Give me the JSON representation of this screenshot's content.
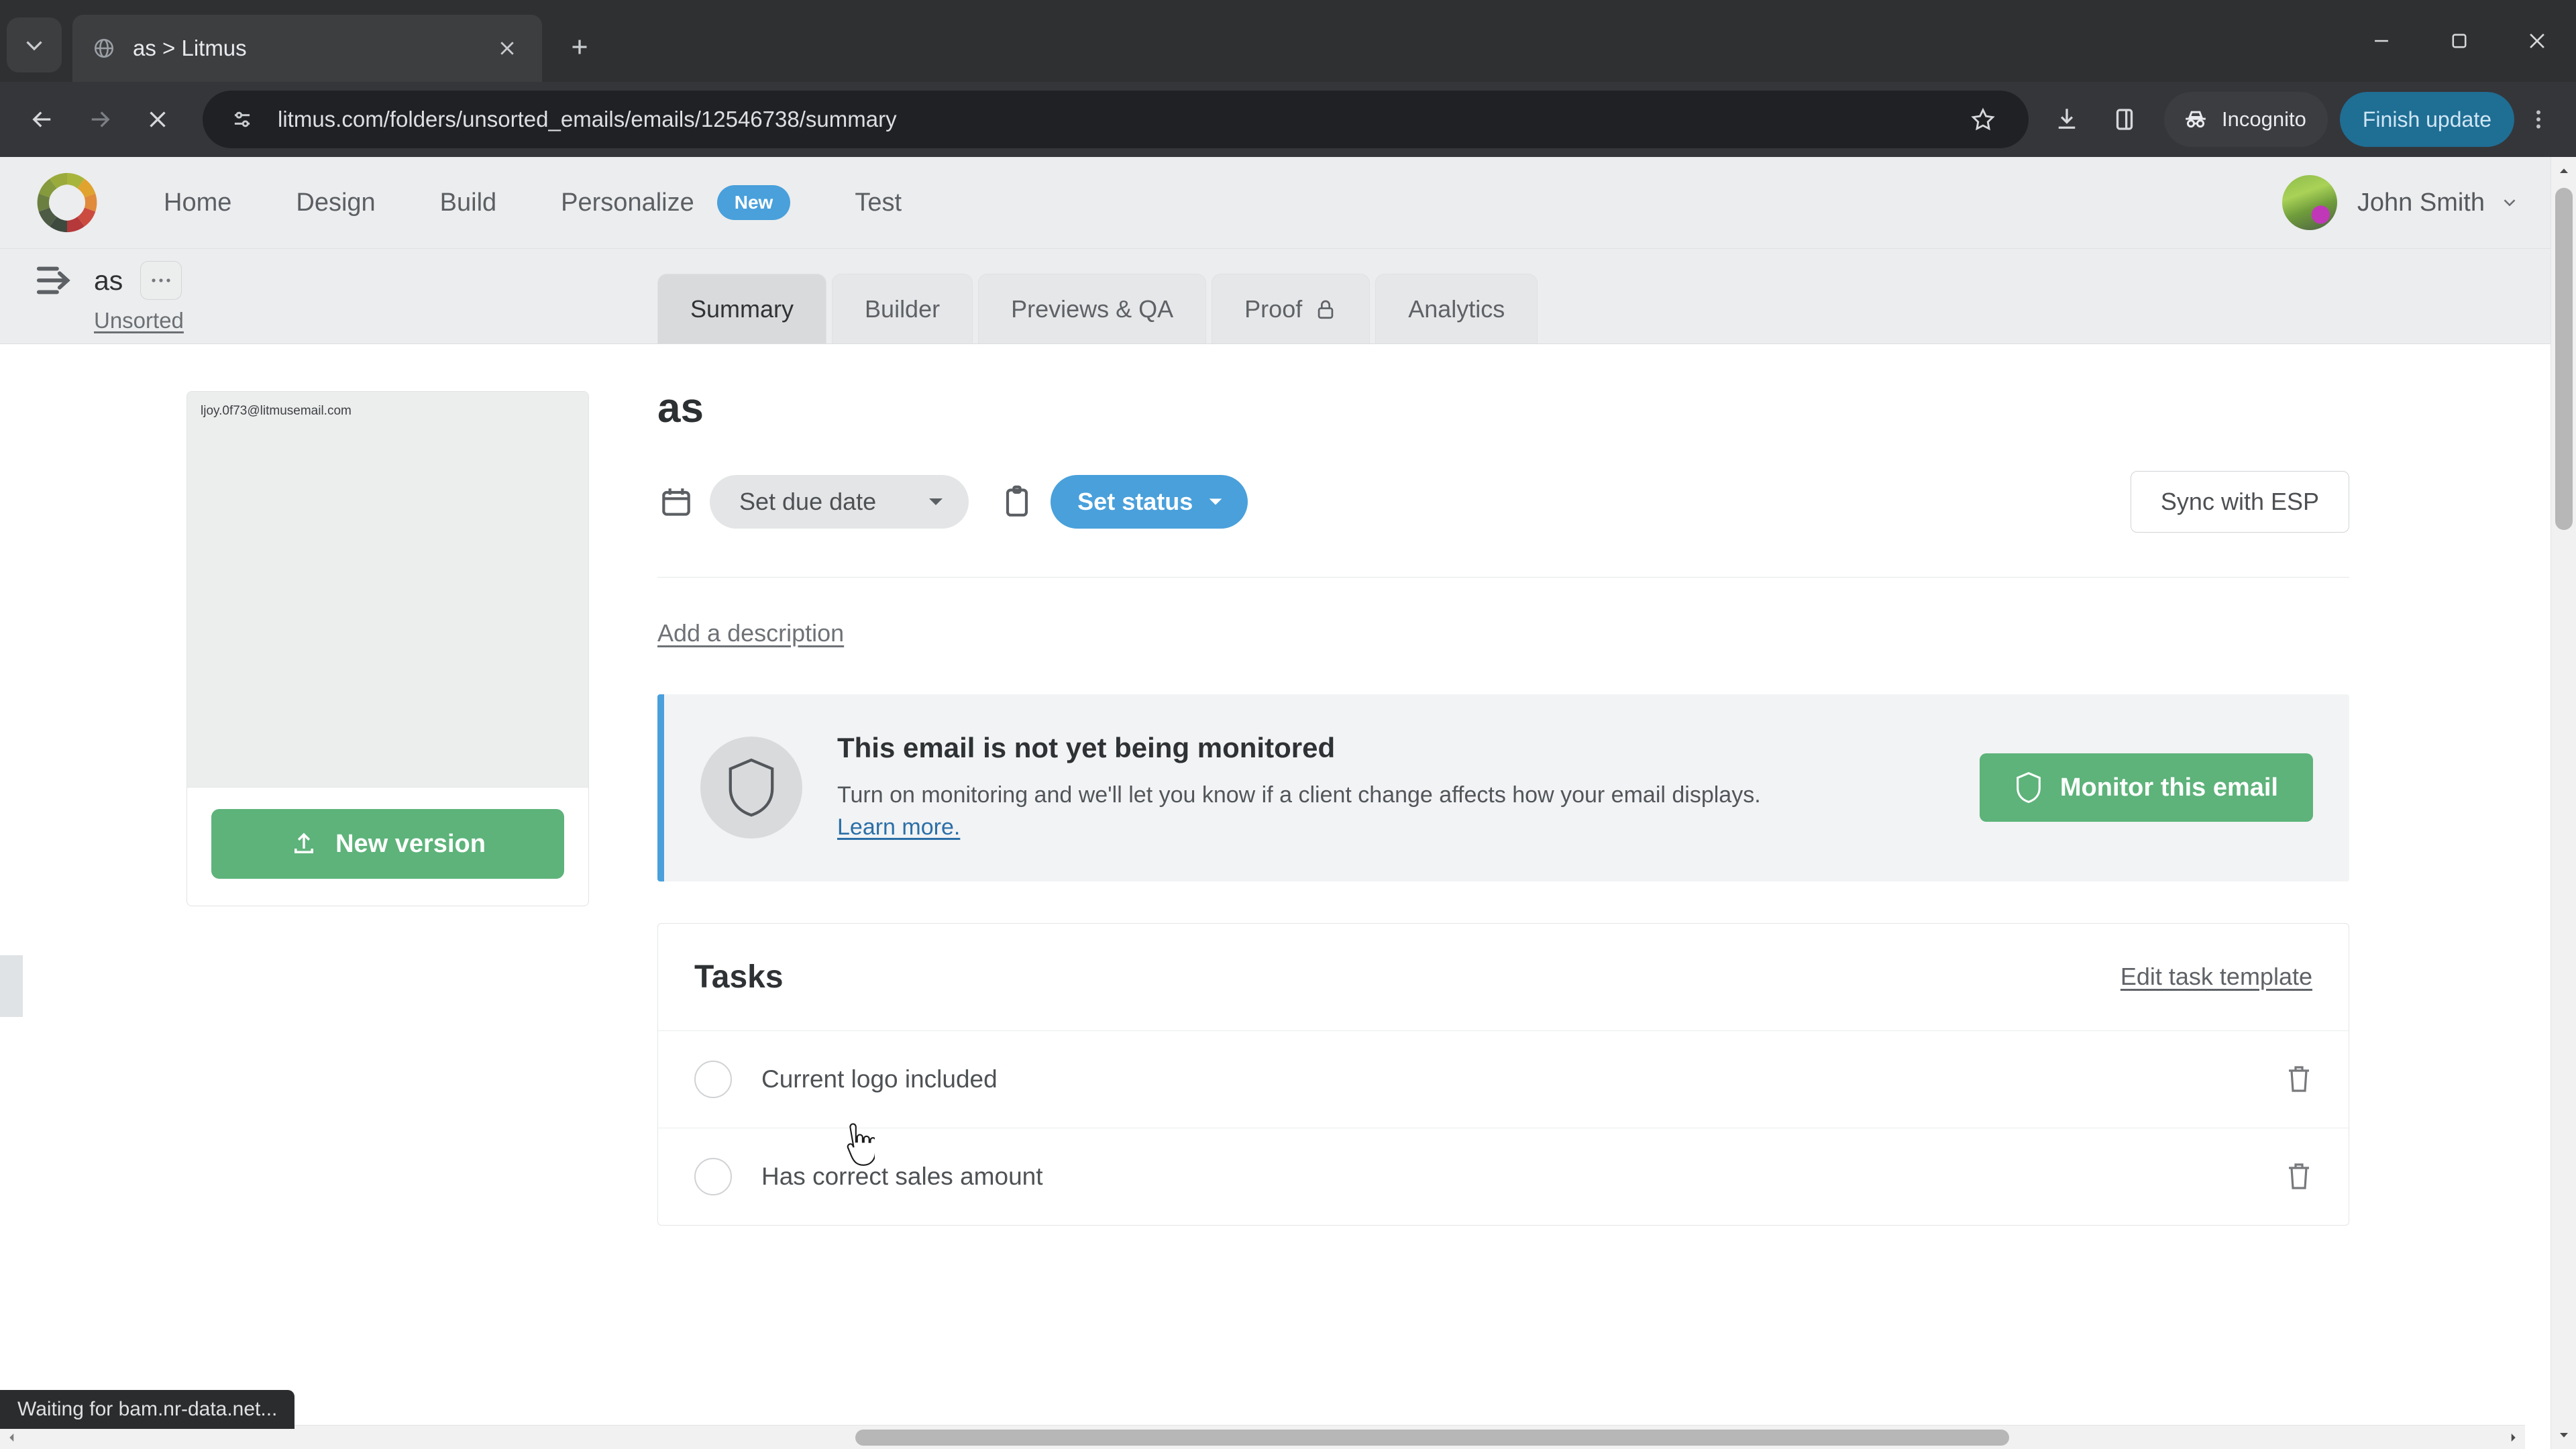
{
  "browser": {
    "tab": {
      "title": "as > Litmus",
      "favicon": "globe-icon",
      "close": "close-icon"
    },
    "new_tab_label": "+",
    "window_controls": {
      "minimize": "minimize-icon",
      "maximize": "maximize-icon",
      "close": "close-icon"
    },
    "nav": {
      "back": "back-arrow-icon",
      "forward": "forward-arrow-icon",
      "stop": "stop-x-icon"
    },
    "omnibox": {
      "site_settings_icon": "tune-icon",
      "url": "litmus.com/folders/unsorted_emails/emails/12546738/summary",
      "bookmark_icon": "star-icon"
    },
    "toolbar": {
      "download_icon": "download-icon",
      "side_panel_icon": "side-panel-icon",
      "incognito_label": "Incognito",
      "incognito_icon": "incognito-icon",
      "finish_update_label": "Finish update",
      "menu_icon": "kebab-menu-icon"
    },
    "status_text": "Waiting for bam.nr-data.net..."
  },
  "app": {
    "logo": "litmus-color-wheel-logo",
    "nav_items": [
      {
        "label": "Home"
      },
      {
        "label": "Design"
      },
      {
        "label": "Build"
      },
      {
        "label": "Personalize",
        "badge": "New"
      },
      {
        "label": "Test"
      }
    ],
    "user": {
      "name": "John Smith",
      "avatar": "user-avatar",
      "caret": "chevron-down-icon"
    }
  },
  "breadcrumb": {
    "toggle_icon": "sidebar-expand-icon",
    "title": "as",
    "more_icon": "ellipsis-icon",
    "folder_link": "Unsorted"
  },
  "tabs": [
    {
      "label": "Summary",
      "active": true
    },
    {
      "label": "Builder",
      "active": false
    },
    {
      "label": "Previews & QA",
      "active": false
    },
    {
      "label": "Proof",
      "active": false,
      "icon": "lock-icon"
    },
    {
      "label": "Analytics",
      "active": false
    }
  ],
  "preview": {
    "email_address": "ljoy.0f73@litmusemail.com",
    "new_version_label": "New version",
    "new_version_icon": "upload-icon"
  },
  "main": {
    "title": "as",
    "due_date": {
      "icon": "calendar-icon",
      "label": "Set due date",
      "caret": "chevron-down-icon"
    },
    "status": {
      "icon": "clipboard-icon",
      "label": "Set status",
      "caret": "chevron-down-icon"
    },
    "sync_label": "Sync with ESP",
    "add_description": "Add a description"
  },
  "monitor_banner": {
    "icon": "shield-icon",
    "title": "This email is not yet being monitored",
    "body": "Turn on monitoring and we'll let you know if a client change affects how your email displays.",
    "link": "Learn more.",
    "button_label": "Monitor this email",
    "button_icon": "shield-icon",
    "accent_color": "#49a0db",
    "button_color": "#5db37a"
  },
  "tasks": {
    "title": "Tasks",
    "edit_link": "Edit task template",
    "items": [
      {
        "label": "Current logo included",
        "checked": false,
        "delete_icon": "trash-icon"
      },
      {
        "label": "Has correct sales amount",
        "checked": false,
        "delete_icon": "trash-icon"
      }
    ]
  }
}
